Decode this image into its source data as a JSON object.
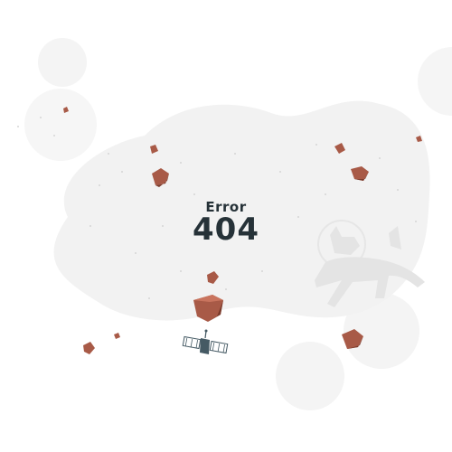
{
  "error": {
    "label": "Error",
    "code": "404"
  },
  "colors": {
    "background": "#ffffff",
    "blob": "#f2f2f2",
    "text": "#263238",
    "rock": "#a85a47",
    "rock_shadow": "#7a3b2c",
    "satellite": "#455a64"
  },
  "icons": [
    "asteroid-icon",
    "satellite-icon",
    "astronaut-dog-icon",
    "planet-icon"
  ]
}
